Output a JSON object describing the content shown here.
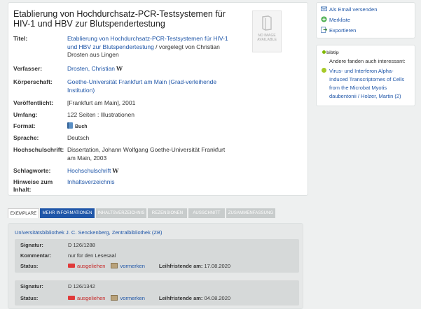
{
  "record": {
    "title": "Etablierung von Hochdurchsatz-PCR-Testsystemen für HIV-1 und HBV zur Blutspendertestung",
    "no_image_text": "NO IMAGE AVAILABLE",
    "fields": {
      "titel_label": "Titel:",
      "titel_link": "Etablierung von Hochdurchsatz-PCR-Testsystemen für HIV-1 und HBV zur Blutspendertestung",
      "titel_rest": " / vorgelegt von Christian Drosten aus Lingen",
      "verfasser_label": "Verfasser:",
      "verfasser_link": "Drosten, Christian",
      "koerperschaft_label": "Körperschaft:",
      "koerperschaft_link": "Goethe-Universität Frankfurt am Main (Grad-verleihende Institution)",
      "veroeffentlicht_label": "Veröffentlicht:",
      "veroeffentlicht_value": "[Frankfurt am Main], 2001",
      "umfang_label": "Umfang:",
      "umfang_value": "122 Seiten : Illustrationen",
      "format_label": "Format:",
      "format_value": "Buch",
      "sprache_label": "Sprache:",
      "sprache_value": "Deutsch",
      "hochschulschrift_label": "Hochschulschrift:",
      "hochschulschrift_value": "Dissertation, Johann Wolfgang Goethe-Universität Frankfurt am Main, 2003",
      "schlagworte_label": "Schlagworte:",
      "schlagworte_link": "Hochschulschrift",
      "hinweise_label_1": "Hinweise zum",
      "hinweise_label_2": "Inhalt:",
      "hinweise_link": "Inhaltsverzeichnis",
      "wiki_glyph": "W"
    }
  },
  "sidebar": {
    "email": "Als Email versenden",
    "merkliste": "Merkliste",
    "exportieren": "Exportieren",
    "bibtip": "bibtip",
    "also_found": "Andere fanden auch interessant:",
    "recommendation": "Virus- und Interferon Alpha-Induced Transcriptomes of Cells from the Microbat Myotis daubentonii / Holzer, Martin (2)"
  },
  "tabs": [
    {
      "label": "Exemplare"
    },
    {
      "label": "Mehr Informationen"
    },
    {
      "label": "Inhaltsverzeichnis"
    },
    {
      "label": "Rezensionen"
    },
    {
      "label": "Ausschnitt"
    },
    {
      "label": "Zusammenfassung"
    }
  ],
  "holdings": {
    "library": "Universitätsbibliothek J. C. Senckenberg, Zentralbibliothek (ZB)",
    "signatur_label": "Signatur:",
    "kommentar_label": "Kommentar:",
    "status_label": "Status:",
    "ausgeliehen": "ausgeliehen",
    "vormerken": "vormerken",
    "leihfrist_label": "Leihfristende am:",
    "copies": [
      {
        "signatur": "D 126/1288",
        "kommentar": "nur für den Lesesaal",
        "leihfrist": "17.08.2020"
      },
      {
        "signatur": "D 126/1342",
        "leihfrist": "04.08.2020"
      }
    ]
  },
  "colors": {
    "link": "#1f56a8",
    "status_red": "#c62828",
    "tab_selected": "#1f56a8",
    "background": "#eef0f0"
  }
}
